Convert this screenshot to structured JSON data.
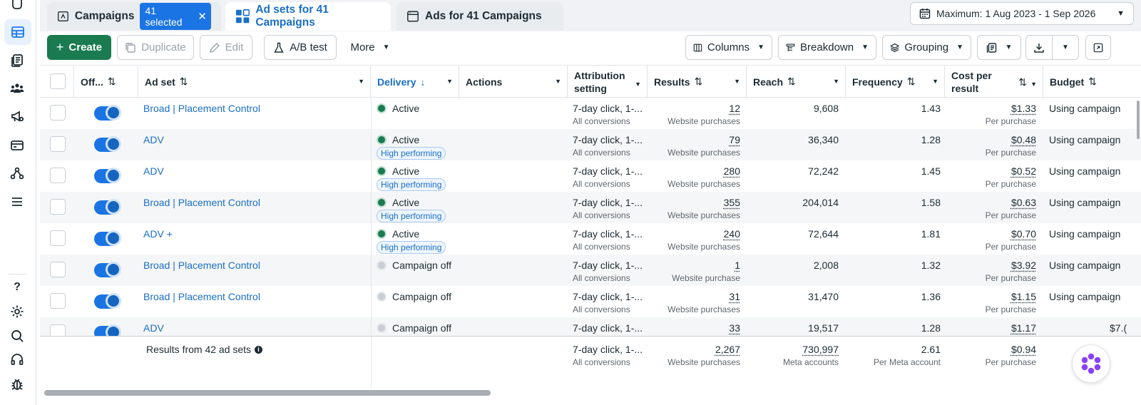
{
  "tabs": {
    "campaigns": "Campaigns",
    "selected_badge": "41 selected",
    "ad_sets": "Ad sets for 41 Campaigns",
    "ads": "Ads for 41 Campaigns"
  },
  "date_range": "Maximum: 1 Aug 2023 - 1 Sep 2026",
  "toolbar": {
    "create": "Create",
    "duplicate": "Duplicate",
    "edit": "Edit",
    "ab_test": "A/B test",
    "more": "More",
    "columns": "Columns",
    "breakdown": "Breakdown",
    "grouping": "Grouping"
  },
  "headers": {
    "off": "Off...",
    "ad_set": "Ad set",
    "delivery": "Delivery",
    "actions": "Actions",
    "attribution_1": "Attribution",
    "attribution_2": "setting",
    "results": "Results",
    "reach": "Reach",
    "frequency": "Frequency",
    "cpr_1": "Cost per",
    "cpr_2": "result",
    "budget": "Budget"
  },
  "rows": [
    {
      "name": "Broad | Placement Control",
      "delivery": "Active",
      "badge": "",
      "attribution": "7-day click, 1-...",
      "attribution_sub": "All conversions",
      "results": "12",
      "results_sub": "Website purchases",
      "reach": "9,608",
      "frequency": "1.43",
      "cpr": "$1.33",
      "cpr_sub": "Per purchase",
      "budget": "Using campaign"
    },
    {
      "name": "ADV",
      "delivery": "Active",
      "badge": "High performing",
      "attribution": "7-day click, 1-...",
      "attribution_sub": "All conversions",
      "results": "79",
      "results_sub": "Website purchases",
      "reach": "36,340",
      "frequency": "1.28",
      "cpr": "$0.48",
      "cpr_sub": "Per purchase",
      "budget": "Using campaign"
    },
    {
      "name": "ADV",
      "delivery": "Active",
      "badge": "High performing",
      "attribution": "7-day click, 1-...",
      "attribution_sub": "All conversions",
      "results": "280",
      "results_sub": "Website purchases",
      "reach": "72,242",
      "frequency": "1.45",
      "cpr": "$0.52",
      "cpr_sub": "Per purchase",
      "budget": "Using campaign"
    },
    {
      "name": "Broad | Placement Control",
      "delivery": "Active",
      "badge": "High performing",
      "attribution": "7-day click, 1-...",
      "attribution_sub": "All conversions",
      "results": "355",
      "results_sub": "Website purchases",
      "reach": "204,014",
      "frequency": "1.58",
      "cpr": "$0.63",
      "cpr_sub": "Per purchase",
      "budget": "Using campaign"
    },
    {
      "name": "ADV +",
      "delivery": "Active",
      "badge": "High performing",
      "attribution": "7-day click, 1-...",
      "attribution_sub": "All conversions",
      "results": "240",
      "results_sub": "Website purchases",
      "reach": "72,644",
      "frequency": "1.81",
      "cpr": "$0.70",
      "cpr_sub": "Per purchase",
      "budget": "Using campaign"
    },
    {
      "name": "Broad | Placement Control",
      "delivery": "Campaign off",
      "badge": "",
      "attribution": "7-day click, 1-...",
      "attribution_sub": "All conversions",
      "results": "1",
      "results_sub": "Website purchase",
      "reach": "2,008",
      "frequency": "1.32",
      "cpr": "$3.92",
      "cpr_sub": "Per purchase",
      "budget": "Using campaign"
    },
    {
      "name": "Broad | Placement Control",
      "delivery": "Campaign off",
      "badge": "",
      "attribution": "7-day click, 1-...",
      "attribution_sub": "All conversions",
      "results": "31",
      "results_sub": "Website purchases",
      "reach": "31,470",
      "frequency": "1.36",
      "cpr": "$1.15",
      "cpr_sub": "Per purchase",
      "budget": "Using campaign"
    },
    {
      "name": "ADV",
      "delivery": "Campaign off",
      "badge": "",
      "attribution": "7-day click, 1-...",
      "attribution_sub": "",
      "results": "33",
      "results_sub": "",
      "reach": "19,517",
      "frequency": "1.28",
      "cpr": "$1.17",
      "cpr_sub": "",
      "budget": "$7.("
    }
  ],
  "footer": {
    "label": "Results from 42 ad sets",
    "attribution": "7-day click, 1-...",
    "attribution_sub": "All conversions",
    "results": "2,267",
    "results_sub": "Website purchases",
    "reach": "730,997",
    "reach_sub": "Meta accounts",
    "frequency": "2.61",
    "frequency_sub": "Per Meta account",
    "cpr": "$0.94",
    "cpr_sub": "Per purchase"
  },
  "rail": {
    "help": "?"
  },
  "colors": {
    "accent": "#1a6fc7",
    "create_green": "#1a7a50",
    "toggle_blue": "#1b74e4"
  }
}
